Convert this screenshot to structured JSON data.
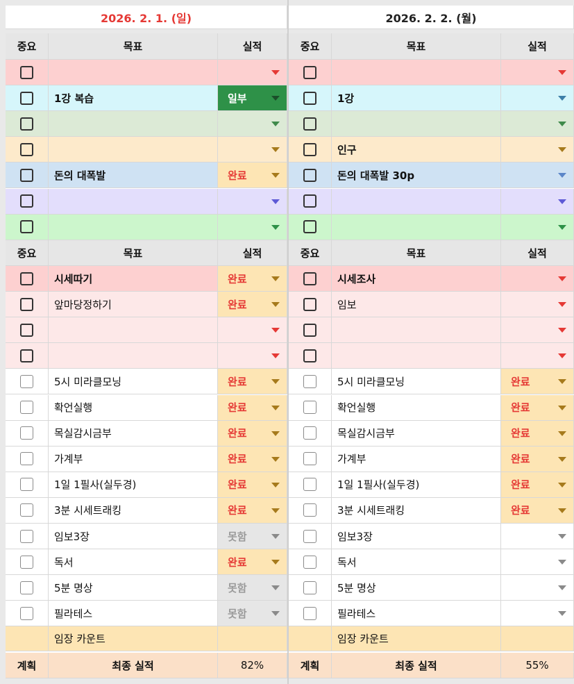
{
  "days": [
    {
      "date": "2026. 2. 1. (일)",
      "date_color": "#e53935",
      "headers": {
        "important": "중요",
        "goal": "목표",
        "result": "실적"
      },
      "top": [
        {
          "goal": "",
          "result": "",
          "bg": "#fdd0d0",
          "res_bg": "#fdd0d0",
          "res_color": "#111",
          "arrow": "#e53935",
          "goal_bold": false
        },
        {
          "goal": "1강 복습",
          "result": "일부",
          "bg": "#d6f6fb",
          "res_bg": "#2e9148",
          "res_color": "#ffffff",
          "arrow": "#1b4e2a",
          "goal_bold": true
        },
        {
          "goal": "",
          "result": "",
          "bg": "#dcead6",
          "res_bg": "#dcead6",
          "res_color": "#111",
          "arrow": "#3f8a4b",
          "goal_bold": false
        },
        {
          "goal": "",
          "result": "",
          "bg": "#fdeacb",
          "res_bg": "#fdeacb",
          "res_color": "#111",
          "arrow": "#a67a1c",
          "goal_bold": false
        },
        {
          "goal": "돈의 대폭발",
          "result": "완료",
          "bg": "#cfe2f3",
          "res_bg": "#fde5b4",
          "res_color": "#e53935",
          "arrow": "#a67a1c",
          "goal_bold": true
        },
        {
          "goal": "",
          "result": "",
          "bg": "#e3defc",
          "res_bg": "#e3defc",
          "res_color": "#111",
          "arrow": "#5e5ad6",
          "goal_bold": false
        },
        {
          "goal": "",
          "result": "",
          "bg": "#ccf6cc",
          "res_bg": "#ccf6cc",
          "res_color": "#111",
          "arrow": "#2e9148",
          "goal_bold": false
        }
      ],
      "bottom": [
        {
          "goal": "시세따기",
          "result": "완료",
          "bg": "#fdd0d0",
          "res_bg": "#fde5b4",
          "res_color": "#e53935",
          "arrow": "#a67a1c",
          "goal_bold": true,
          "cb": "dark"
        },
        {
          "goal": "앞마당정하기",
          "result": "완료",
          "bg": "#fde8e8",
          "res_bg": "#fde5b4",
          "res_color": "#e53935",
          "arrow": "#a67a1c",
          "goal_bold": false,
          "cb": "dark"
        },
        {
          "goal": "",
          "result": "",
          "bg": "#fde8e8",
          "res_bg": "#fde8e8",
          "res_color": "#111",
          "arrow": "#e53935",
          "goal_bold": false,
          "cb": "dark"
        },
        {
          "goal": "",
          "result": "",
          "bg": "#fde8e8",
          "res_bg": "#fde8e8",
          "res_color": "#111",
          "arrow": "#e53935",
          "goal_bold": false,
          "cb": "dark"
        },
        {
          "goal": "5시 미라클모닝",
          "result": "완료",
          "bg": "#ffffff",
          "res_bg": "#fde5b4",
          "res_color": "#e53935",
          "arrow": "#a67a1c",
          "goal_bold": false,
          "cb": "light"
        },
        {
          "goal": "확언실행",
          "result": "완료",
          "bg": "#ffffff",
          "res_bg": "#fde5b4",
          "res_color": "#e53935",
          "arrow": "#a67a1c",
          "goal_bold": false,
          "cb": "light"
        },
        {
          "goal": "목실감시금부",
          "result": "완료",
          "bg": "#ffffff",
          "res_bg": "#fde5b4",
          "res_color": "#e53935",
          "arrow": "#a67a1c",
          "goal_bold": false,
          "cb": "light"
        },
        {
          "goal": "가계부",
          "result": "완료",
          "bg": "#ffffff",
          "res_bg": "#fde5b4",
          "res_color": "#e53935",
          "arrow": "#a67a1c",
          "goal_bold": false,
          "cb": "light"
        },
        {
          "goal": "1일 1필사(실두경)",
          "result": "완료",
          "bg": "#ffffff",
          "res_bg": "#fde5b4",
          "res_color": "#e53935",
          "arrow": "#a67a1c",
          "goal_bold": false,
          "cb": "light"
        },
        {
          "goal": "3분 시세트래킹",
          "result": "완료",
          "bg": "#ffffff",
          "res_bg": "#fde5b4",
          "res_color": "#e53935",
          "arrow": "#a67a1c",
          "goal_bold": false,
          "cb": "light"
        },
        {
          "goal": "임보3장",
          "result": "못함",
          "bg": "#ffffff",
          "res_bg": "#e6e6e6",
          "res_color": "#9a9a9a",
          "arrow": "#8a8a8a",
          "goal_bold": false,
          "cb": "light"
        },
        {
          "goal": "독서",
          "result": "완료",
          "bg": "#ffffff",
          "res_bg": "#fde5b4",
          "res_color": "#e53935",
          "arrow": "#a67a1c",
          "goal_bold": false,
          "cb": "light"
        },
        {
          "goal": "5분 명상",
          "result": "못함",
          "bg": "#ffffff",
          "res_bg": "#e6e6e6",
          "res_color": "#9a9a9a",
          "arrow": "#8a8a8a",
          "goal_bold": false,
          "cb": "light"
        },
        {
          "goal": "필라테스",
          "result": "못함",
          "bg": "#ffffff",
          "res_bg": "#e6e6e6",
          "res_color": "#9a9a9a",
          "arrow": "#8a8a8a",
          "goal_bold": false,
          "cb": "light"
        }
      ],
      "counter_label": "임장 카운트",
      "plan_label": "계획",
      "final_label": "최종 실적",
      "final_value": "82%"
    },
    {
      "date": "2026. 2. 2. (월)",
      "date_color": "#222222",
      "headers": {
        "important": "중요",
        "goal": "목표",
        "result": "실적"
      },
      "top": [
        {
          "goal": "",
          "result": "",
          "bg": "#fdd0d0",
          "res_bg": "#fdd0d0",
          "res_color": "#111",
          "arrow": "#e53935",
          "goal_bold": false
        },
        {
          "goal": "1강",
          "result": "",
          "bg": "#d6f6fb",
          "res_bg": "#d6f6fb",
          "res_color": "#111",
          "arrow": "#3d7fa8",
          "goal_bold": true
        },
        {
          "goal": "",
          "result": "",
          "bg": "#dcead6",
          "res_bg": "#dcead6",
          "res_color": "#111",
          "arrow": "#3f8a4b",
          "goal_bold": false
        },
        {
          "goal": "인구",
          "result": "",
          "bg": "#fdeacb",
          "res_bg": "#fdeacb",
          "res_color": "#111",
          "arrow": "#a67a1c",
          "goal_bold": true
        },
        {
          "goal": "돈의 대폭발 30p",
          "result": "",
          "bg": "#cfe2f3",
          "res_bg": "#cfe2f3",
          "res_color": "#111",
          "arrow": "#5b86c8",
          "goal_bold": true
        },
        {
          "goal": "",
          "result": "",
          "bg": "#e3defc",
          "res_bg": "#e3defc",
          "res_color": "#111",
          "arrow": "#5e5ad6",
          "goal_bold": false
        },
        {
          "goal": "",
          "result": "",
          "bg": "#ccf6cc",
          "res_bg": "#ccf6cc",
          "res_color": "#111",
          "arrow": "#2e9148",
          "goal_bold": false
        }
      ],
      "bottom": [
        {
          "goal": "시세조사",
          "result": "",
          "bg": "#fdd0d0",
          "res_bg": "#fdd0d0",
          "res_color": "#111",
          "arrow": "#e53935",
          "goal_bold": true,
          "cb": "dark"
        },
        {
          "goal": "임보",
          "result": "",
          "bg": "#fde8e8",
          "res_bg": "#fde8e8",
          "res_color": "#111",
          "arrow": "#e53935",
          "goal_bold": false,
          "cb": "dark"
        },
        {
          "goal": "",
          "result": "",
          "bg": "#fde8e8",
          "res_bg": "#fde8e8",
          "res_color": "#111",
          "arrow": "#e53935",
          "goal_bold": false,
          "cb": "dark"
        },
        {
          "goal": "",
          "result": "",
          "bg": "#fde8e8",
          "res_bg": "#fde8e8",
          "res_color": "#111",
          "arrow": "#e53935",
          "goal_bold": false,
          "cb": "dark"
        },
        {
          "goal": "5시 미라클모닝",
          "result": "완료",
          "bg": "#ffffff",
          "res_bg": "#fde5b4",
          "res_color": "#e53935",
          "arrow": "#a67a1c",
          "goal_bold": false,
          "cb": "light"
        },
        {
          "goal": "확언실행",
          "result": "완료",
          "bg": "#ffffff",
          "res_bg": "#fde5b4",
          "res_color": "#e53935",
          "arrow": "#a67a1c",
          "goal_bold": false,
          "cb": "light"
        },
        {
          "goal": "목실감시금부",
          "result": "완료",
          "bg": "#ffffff",
          "res_bg": "#fde5b4",
          "res_color": "#e53935",
          "arrow": "#a67a1c",
          "goal_bold": false,
          "cb": "light"
        },
        {
          "goal": "가계부",
          "result": "완료",
          "bg": "#ffffff",
          "res_bg": "#fde5b4",
          "res_color": "#e53935",
          "arrow": "#a67a1c",
          "goal_bold": false,
          "cb": "light"
        },
        {
          "goal": "1일 1필사(실두경)",
          "result": "완료",
          "bg": "#ffffff",
          "res_bg": "#fde5b4",
          "res_color": "#e53935",
          "arrow": "#a67a1c",
          "goal_bold": false,
          "cb": "light"
        },
        {
          "goal": "3분 시세트래킹",
          "result": "완료",
          "bg": "#ffffff",
          "res_bg": "#fde5b4",
          "res_color": "#e53935",
          "arrow": "#a67a1c",
          "goal_bold": false,
          "cb": "light"
        },
        {
          "goal": "임보3장",
          "result": "",
          "bg": "#ffffff",
          "res_bg": "#ffffff",
          "res_color": "#111",
          "arrow": "#8a8a8a",
          "goal_bold": false,
          "cb": "light"
        },
        {
          "goal": "독서",
          "result": "",
          "bg": "#ffffff",
          "res_bg": "#ffffff",
          "res_color": "#111",
          "arrow": "#8a8a8a",
          "goal_bold": false,
          "cb": "light"
        },
        {
          "goal": "5분 명상",
          "result": "",
          "bg": "#ffffff",
          "res_bg": "#ffffff",
          "res_color": "#111",
          "arrow": "#8a8a8a",
          "goal_bold": false,
          "cb": "light"
        },
        {
          "goal": "필라테스",
          "result": "",
          "bg": "#ffffff",
          "res_bg": "#ffffff",
          "res_color": "#111",
          "arrow": "#8a8a8a",
          "goal_bold": false,
          "cb": "light"
        }
      ],
      "counter_label": "임장 카운트",
      "plan_label": "계획",
      "final_label": "최종 실적",
      "final_value": "55%"
    }
  ]
}
